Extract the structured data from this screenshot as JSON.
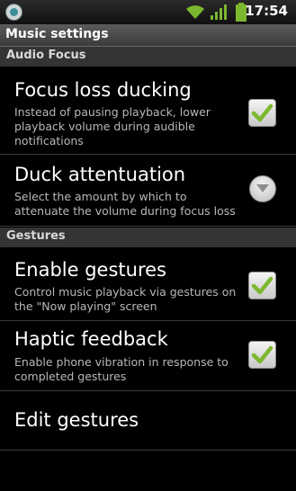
{
  "status": {
    "time": "17:54"
  },
  "titlebar": {
    "title": "Music settings"
  },
  "sections": {
    "audio_focus": "Audio Focus",
    "gestures": "Gestures"
  },
  "prefs": {
    "focus_loss": {
      "title": "Focus loss ducking",
      "summary": "Instead of pausing playback, lower playback volume during audible notifications",
      "checked": true
    },
    "duck_att": {
      "title": "Duck attentuation",
      "summary": "Select the amount by which to attenuate the volume during focus loss"
    },
    "enable_gestures": {
      "title": "Enable gestures",
      "summary": "Control music playback via gestures on the \"Now playing\" screen",
      "checked": true
    },
    "haptic": {
      "title": "Haptic feedback",
      "summary": "Enable phone vibration in response to completed gestures",
      "checked": true
    },
    "edit_gestures": {
      "title": "Edit gestures"
    }
  },
  "colors": {
    "check": "#7cb82f",
    "background": "#000000",
    "section": "#343434"
  }
}
